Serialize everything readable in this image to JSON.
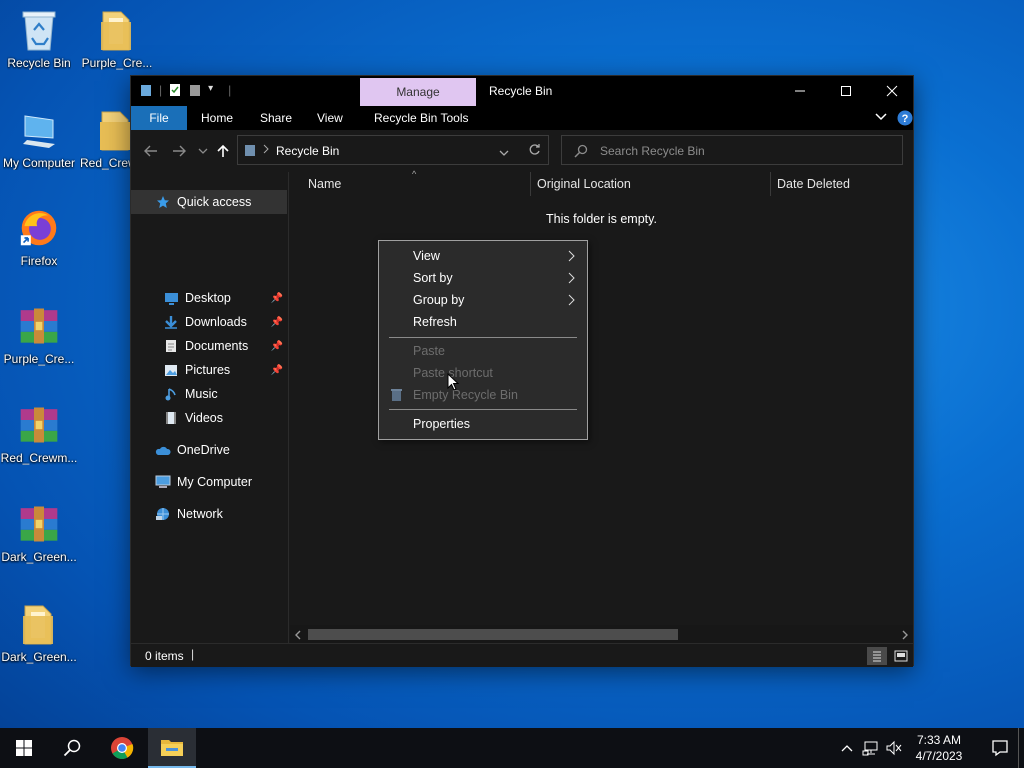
{
  "desktop": {
    "icons": [
      {
        "label": "Recycle Bin",
        "icon": "recycle-bin-icon"
      },
      {
        "label": "Purple_Cre...",
        "icon": "folder-icon"
      },
      {
        "label": "My Computer",
        "icon": "computer-icon"
      },
      {
        "label": "Red_Crew",
        "icon": "folder-icon"
      },
      {
        "label": "Firefox",
        "icon": "firefox-icon"
      },
      {
        "label": "Purple_Cre...",
        "icon": "winrar-archive-icon"
      },
      {
        "label": "Red_Crewm...",
        "icon": "winrar-archive-icon"
      },
      {
        "label": "Dark_Green...",
        "icon": "winrar-archive-icon"
      },
      {
        "label": "Dark_Green...",
        "icon": "folder-icon"
      }
    ]
  },
  "window": {
    "title": "Recycle Bin",
    "context_tab": "Manage",
    "ribbon_tabs": [
      "File",
      "Home",
      "Share",
      "View",
      "Recycle Bin Tools"
    ],
    "address_path": "Recycle Bin",
    "search_placeholder": "Search Recycle Bin",
    "accent_color": "#1a6fb8",
    "manage_color": "#e0c6f1"
  },
  "sidebar": {
    "items": [
      {
        "label": "Quick access",
        "icon": "star-icon",
        "pinned": false
      },
      {
        "label": "Desktop",
        "icon": "desktop-icon",
        "pinned": true
      },
      {
        "label": "Downloads",
        "icon": "downloads-icon",
        "pinned": true
      },
      {
        "label": "Documents",
        "icon": "documents-icon",
        "pinned": true
      },
      {
        "label": "Pictures",
        "icon": "pictures-icon",
        "pinned": true
      },
      {
        "label": "Music",
        "icon": "music-icon",
        "pinned": false
      },
      {
        "label": "Videos",
        "icon": "videos-icon",
        "pinned": false
      },
      {
        "label": "OneDrive",
        "icon": "onedrive-icon",
        "pinned": false
      },
      {
        "label": "My Computer",
        "icon": "computer-icon",
        "pinned": false
      },
      {
        "label": "Network",
        "icon": "network-icon",
        "pinned": false
      }
    ]
  },
  "content": {
    "columns": [
      "Name",
      "Original Location",
      "Date Deleted"
    ],
    "empty_message": "This folder is empty."
  },
  "context_menu": {
    "items": [
      {
        "label": "View",
        "submenu": true,
        "disabled": false
      },
      {
        "label": "Sort by",
        "submenu": true,
        "disabled": false
      },
      {
        "label": "Group by",
        "submenu": true,
        "disabled": false
      },
      {
        "label": "Refresh",
        "submenu": false,
        "disabled": false
      },
      {
        "label": "Paste",
        "submenu": false,
        "disabled": true
      },
      {
        "label": "Paste shortcut",
        "submenu": false,
        "disabled": true
      },
      {
        "label": "Empty Recycle Bin",
        "submenu": false,
        "disabled": true
      },
      {
        "label": "Properties",
        "submenu": false,
        "disabled": false
      }
    ]
  },
  "status": {
    "item_count": "0 items"
  },
  "taskbar": {
    "time": "7:33 AM",
    "date": "4/7/2023"
  }
}
